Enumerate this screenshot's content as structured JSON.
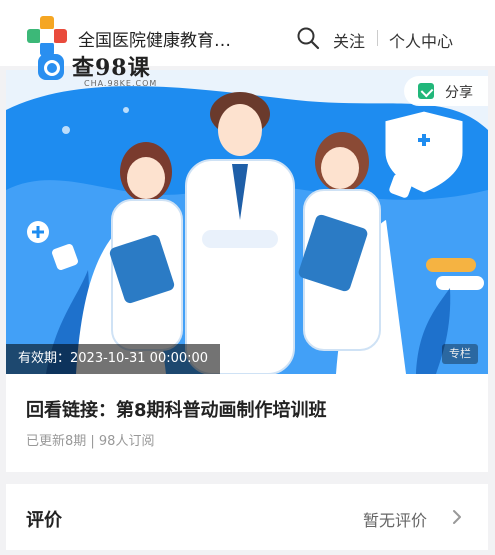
{
  "header": {
    "site_title": "全国医院健康教育…",
    "follow_label": "关注",
    "personal_center_label": "个人中心"
  },
  "watermark": {
    "text": "查98课",
    "sub": "CHA.98KE.COM"
  },
  "banner": {
    "share_label": "分享",
    "validity": "有效期：2023-10-31 00:00:00",
    "tag": "专栏"
  },
  "course": {
    "title": "回看链接：第8期科普动画制作培训班",
    "meta": "已更新8期 | 98人订阅"
  },
  "review": {
    "title": "评价",
    "status": "暂无评价"
  }
}
